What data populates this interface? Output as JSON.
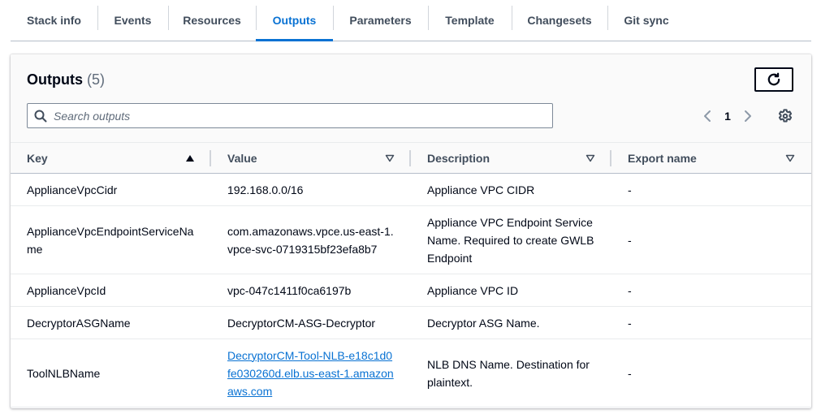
{
  "tabs": [
    {
      "label": "Stack info"
    },
    {
      "label": "Events"
    },
    {
      "label": "Resources"
    },
    {
      "label": "Outputs"
    },
    {
      "label": "Parameters"
    },
    {
      "label": "Template"
    },
    {
      "label": "Changesets"
    },
    {
      "label": "Git sync"
    }
  ],
  "active_tab": "Outputs",
  "panel": {
    "title": "Outputs",
    "count": "(5)"
  },
  "search": {
    "placeholder": "Search outputs",
    "value": ""
  },
  "pagination": {
    "current_page": "1"
  },
  "columns": [
    {
      "label": "Key",
      "sort": "ascending"
    },
    {
      "label": "Value",
      "sort": "none"
    },
    {
      "label": "Description",
      "sort": "none"
    },
    {
      "label": "Export name",
      "sort": "none"
    }
  ],
  "rows": [
    {
      "key": "ApplianceVpcCidr",
      "value": "192.168.0.0/16",
      "description": "Appliance VPC CIDR",
      "export": "-"
    },
    {
      "key": "ApplianceVpcEndpointServiceName",
      "value": "com.amazonaws.vpce.us-east-1.vpce-svc-0719315bf23efa8b7",
      "description": "Appliance VPC Endpoint Service Name. Required to create GWLB Endpoint",
      "export": "-"
    },
    {
      "key": "ApplianceVpcId",
      "value": "vpc-047c1411f0ca6197b",
      "description": "Appliance VPC ID",
      "export": "-"
    },
    {
      "key": "DecryptorASGName",
      "value": "DecryptorCM-ASG-Decryptor",
      "description": "Decryptor ASG Name.",
      "export": "-"
    },
    {
      "key": "ToolNLBName",
      "value": "DecryptorCM-Tool-NLB-e18c1d0fe030260d.elb.us-east-1.amazonaws.com",
      "description": "NLB DNS Name. Destination for plaintext.",
      "export": "-"
    }
  ],
  "colors": {
    "accent": "#0972d3",
    "text": "#000716",
    "secondary_text": "#414d5c"
  }
}
